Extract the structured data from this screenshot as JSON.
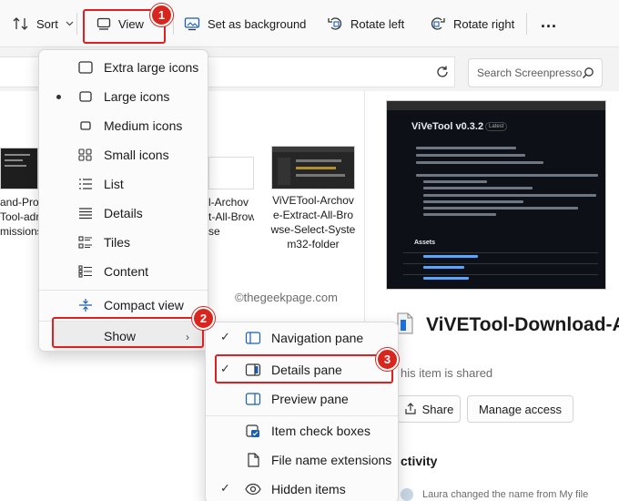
{
  "toolbar": {
    "sort_label": "Sort",
    "view_label": "View",
    "set_background_label": "Set as background",
    "rotate_left_label": "Rotate left",
    "rotate_right_label": "Rotate right",
    "more_label": "..."
  },
  "search": {
    "placeholder": "Search Screenpresso"
  },
  "files": [
    {
      "name_line1": "and-Pro",
      "name_line2": "Tool-adr",
      "name_line3": "missions"
    },
    {
      "name_line1": "l-Archov",
      "name_line2": "t-All-Brow",
      "name_line3": "se"
    },
    {
      "name_line1": "ViVETool-Archov",
      "name_line2": "e-Extract-All-Bro",
      "name_line3": "wse-Select-Syste",
      "name_line4": "m32-folder"
    }
  ],
  "watermark": "©thegeekpage.com",
  "view_menu": {
    "items": [
      {
        "label": "Extra large icons",
        "icon": "extra-large-icons-icon",
        "selected": false
      },
      {
        "label": "Large icons",
        "icon": "large-icons-icon",
        "selected": true
      },
      {
        "label": "Medium icons",
        "icon": "medium-icons-icon",
        "selected": false
      },
      {
        "label": "Small icons",
        "icon": "small-icons-icon",
        "selected": false
      },
      {
        "label": "List",
        "icon": "list-icon",
        "selected": false
      },
      {
        "label": "Details",
        "icon": "details-icon",
        "selected": false
      },
      {
        "label": "Tiles",
        "icon": "tiles-icon",
        "selected": false
      },
      {
        "label": "Content",
        "icon": "content-icon",
        "selected": false
      },
      {
        "label": "Compact view",
        "icon": "compact-view-icon",
        "selected": false
      },
      {
        "label": "Show",
        "icon": "",
        "selected": false
      }
    ]
  },
  "show_menu": {
    "items": [
      {
        "label": "Navigation pane",
        "checked": true,
        "icon": "navigation-pane-icon"
      },
      {
        "label": "Details pane",
        "checked": true,
        "icon": "details-pane-icon"
      },
      {
        "label": "Preview pane",
        "checked": false,
        "icon": "preview-pane-icon"
      },
      {
        "label": "Item check boxes",
        "checked": false,
        "icon": "check-box-icon"
      },
      {
        "label": "File name extensions",
        "checked": false,
        "icon": "file-icon"
      },
      {
        "label": "Hidden items",
        "checked": true,
        "icon": "eye-icon"
      }
    ],
    "check_glyph": "✓"
  },
  "details_pane": {
    "preview_title": "ViVeTool v0.3.2",
    "preview_tag": "Latest",
    "preview_assets": "Assets",
    "file_title": "ViVETool-Download-A",
    "shared_text": "his item is shared",
    "share_label": "Share",
    "manage_access_label": "Manage access",
    "activity_heading": "ctivity",
    "activity_line": "Laura changed the name from My file"
  },
  "annotations": {
    "badge1": "1",
    "badge2": "2",
    "badge3": "3"
  },
  "colors": {
    "annotation_red": "#d8261f",
    "accent_blue": "#0067c0"
  }
}
